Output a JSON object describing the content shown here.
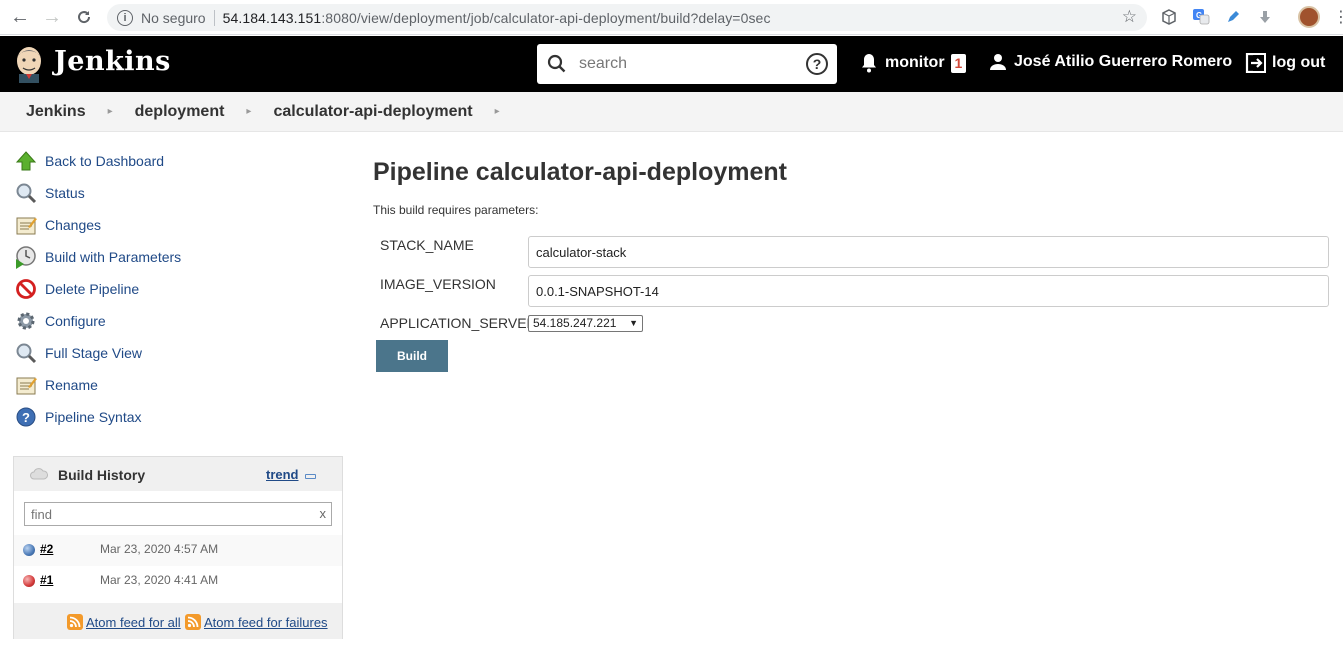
{
  "browser": {
    "security_label": "No seguro",
    "url_host": "54.184.143.151",
    "url_rest": ":8080/view/deployment/job/calculator-api-deployment/build?delay=0sec"
  },
  "header": {
    "brand": "Jenkins",
    "search_placeholder": "search",
    "monitor_label": "monitor",
    "monitor_count": "1",
    "user_name": "José Atilio Guerrero Romero",
    "logout_label": "log out"
  },
  "breadcrumbs": [
    "Jenkins",
    "deployment",
    "calculator-api-deployment"
  ],
  "sidebar": {
    "tasks": [
      {
        "label": "Back to Dashboard",
        "icon": "up-arrow-icon"
      },
      {
        "label": "Status",
        "icon": "magnifier-icon"
      },
      {
        "label": "Changes",
        "icon": "notepad-icon"
      },
      {
        "label": "Build with Parameters",
        "icon": "clock-play-icon"
      },
      {
        "label": "Delete Pipeline",
        "icon": "no-entry-icon"
      },
      {
        "label": "Configure",
        "icon": "gear-icon"
      },
      {
        "label": "Full Stage View",
        "icon": "magnifier-icon"
      },
      {
        "label": "Rename",
        "icon": "notepad-icon"
      },
      {
        "label": "Pipeline Syntax",
        "icon": "help-icon"
      }
    ],
    "history": {
      "title": "Build History",
      "trend_label": "trend",
      "find_placeholder": "find",
      "find_clear": "x",
      "builds": [
        {
          "number": "#2",
          "date": "Mar 23, 2020 4:57 AM",
          "status_color": "#4a79b6"
        },
        {
          "number": "#1",
          "date": "Mar 23, 2020 4:41 AM",
          "status_color": "#d33a3a"
        }
      ],
      "feed_all": "Atom feed for all",
      "feed_failures": "Atom feed for failures"
    }
  },
  "main": {
    "title": "Pipeline calculator-api-deployment",
    "requires_text": "This build requires parameters:",
    "params": [
      {
        "name": "STACK_NAME",
        "value": "calculator-stack"
      },
      {
        "name": "IMAGE_VERSION",
        "value": "0.0.1-SNAPSHOT-14"
      },
      {
        "name": "APPLICATION_SERVER",
        "value": "54.185.247.221"
      }
    ],
    "build_button": "Build"
  },
  "colors": {
    "link": "#204a87",
    "build_button": "#4b758b",
    "header_bg": "#000000"
  }
}
